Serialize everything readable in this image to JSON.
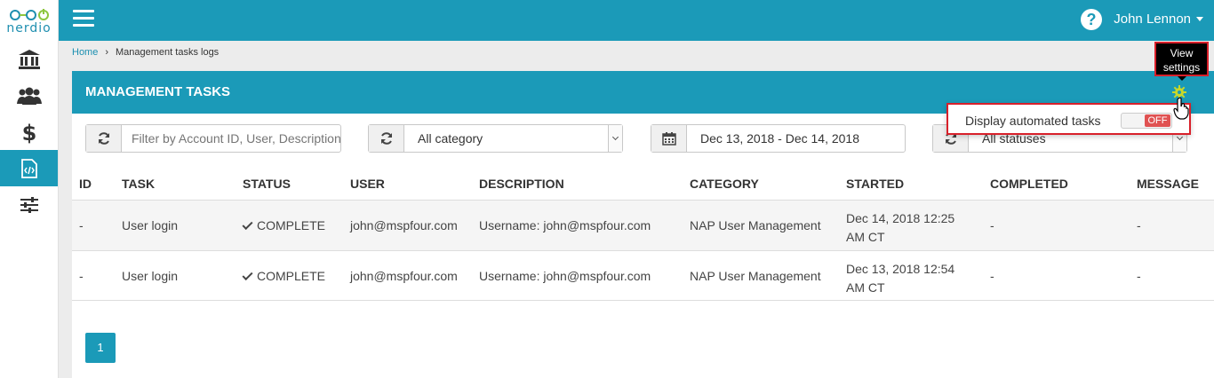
{
  "app": {
    "logo_text": "nerdio"
  },
  "colors": {
    "primary": "#1b9ab8",
    "highlight": "#d8202a",
    "toggle_off": "#e05252"
  },
  "sidebar": {
    "items": [
      {
        "icon": "bank-icon",
        "active": false
      },
      {
        "icon": "users-icon",
        "active": false
      },
      {
        "icon": "dollar-icon",
        "active": false
      },
      {
        "icon": "code-file-icon",
        "active": true
      },
      {
        "icon": "sliders-icon",
        "active": false
      }
    ]
  },
  "topbar": {
    "help_label": "?",
    "user_name": "John Lennon"
  },
  "breadcrumb": {
    "home": "Home",
    "separator": "›",
    "current": "Management tasks logs"
  },
  "panel": {
    "title": "MANAGEMENT TASKS"
  },
  "filters": {
    "search_placeholder": "Filter by Account ID, User, Description",
    "category_value": "All category",
    "date_range": "Dec 13, 2018 - Dec 14, 2018",
    "status_value": "All statuses"
  },
  "table": {
    "columns": [
      "ID",
      "TASK",
      "STATUS",
      "USER",
      "DESCRIPTION",
      "CATEGORY",
      "STARTED",
      "COMPLETED",
      "MESSAGE"
    ],
    "rows": [
      {
        "id": "-",
        "task": "User login",
        "status": "COMPLETE",
        "user": "john@mspfour.com",
        "description": "Username: john@mspfour.com",
        "category": "NAP User Management",
        "started": "Dec 14, 2018 12:25 AM CT",
        "completed": "-",
        "message": "-"
      },
      {
        "id": "-",
        "task": "User login",
        "status": "COMPLETE",
        "user": "john@mspfour.com",
        "description": "Username: john@mspfour.com",
        "category": "NAP User Management",
        "started": "Dec 13, 2018 12:54 AM CT",
        "completed": "-",
        "message": "-"
      }
    ]
  },
  "pagination": {
    "current_page": "1"
  },
  "tooltip": {
    "text": "View settings"
  },
  "settings_popover": {
    "label": "Display automated tasks",
    "toggle_state": "OFF"
  }
}
